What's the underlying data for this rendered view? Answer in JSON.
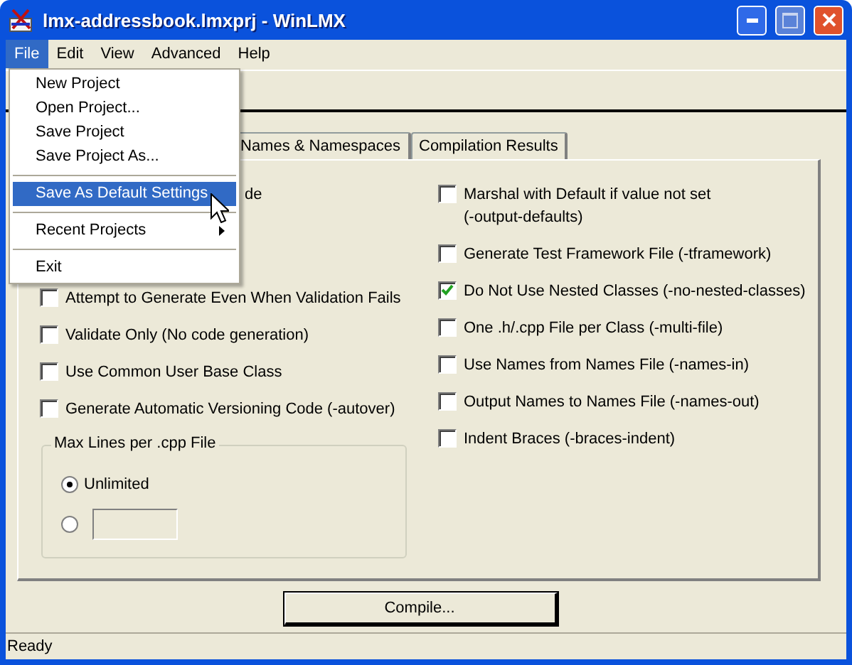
{
  "window": {
    "title": "lmx-addressbook.lmxprj - WinLMX"
  },
  "menu_bar": [
    {
      "label": "File",
      "selected": true
    },
    {
      "label": "Edit",
      "selected": false
    },
    {
      "label": "View",
      "selected": false
    },
    {
      "label": "Advanced",
      "selected": false
    },
    {
      "label": "Help",
      "selected": false
    }
  ],
  "file_menu": [
    {
      "kind": "item",
      "label": "New Project",
      "selected": false
    },
    {
      "kind": "item",
      "label": "Open Project...",
      "selected": false
    },
    {
      "kind": "item",
      "label": "Save Project",
      "selected": false
    },
    {
      "kind": "item",
      "label": "Save Project As...",
      "selected": false
    },
    {
      "kind": "separator"
    },
    {
      "kind": "item",
      "label": "Save As Default Settings",
      "selected": true
    },
    {
      "kind": "separator"
    },
    {
      "kind": "submenu",
      "label": "Recent Projects",
      "selected": false
    },
    {
      "kind": "separator"
    },
    {
      "kind": "item",
      "label": "Exit",
      "selected": false
    }
  ],
  "tabs": [
    {
      "label": "Names & Namespaces",
      "selected": false
    },
    {
      "label": "Compilation Results",
      "selected": false
    }
  ],
  "left_options": [
    {
      "kind": "cut",
      "label": "de"
    },
    {
      "kind": "checkbox",
      "label": "Attempt to Generate Even When Validation Fails",
      "checked": false
    },
    {
      "kind": "checkbox",
      "label": "Validate Only (No code generation)",
      "checked": false
    },
    {
      "kind": "checkbox",
      "label": "Use Common User Base Class",
      "checked": false
    },
    {
      "kind": "checkbox",
      "label": "Generate Automatic Versioning Code (-autover)",
      "checked": false
    }
  ],
  "max_lines_group": {
    "title": "Max Lines per .cpp File",
    "options": [
      {
        "kind": "label",
        "label": "Unlimited",
        "selected": true
      },
      {
        "kind": "field",
        "selected": false
      }
    ]
  },
  "right_options": [
    {
      "kind": "checkbox",
      "label": "Marshal with Default if value not set\n(-output-defaults)",
      "checked": false
    },
    {
      "kind": "checkbox",
      "label": "Generate Test Framework File (-tframework)",
      "checked": false
    },
    {
      "kind": "checkbox",
      "label": "Do Not Use Nested Classes (-no-nested-classes)",
      "checked": true
    },
    {
      "kind": "checkbox",
      "label": "One .h/.cpp File per Class (-multi-file)",
      "checked": false
    },
    {
      "kind": "checkbox",
      "label": "Use Names from Names File (-names-in)",
      "checked": false
    },
    {
      "kind": "checkbox",
      "label": "Output Names to Names File (-names-out)",
      "checked": false
    },
    {
      "kind": "checkbox",
      "label": "Indent Braces (-braces-indent)",
      "checked": false
    }
  ],
  "compile_button": "Compile...",
  "status_bar": "Ready"
}
